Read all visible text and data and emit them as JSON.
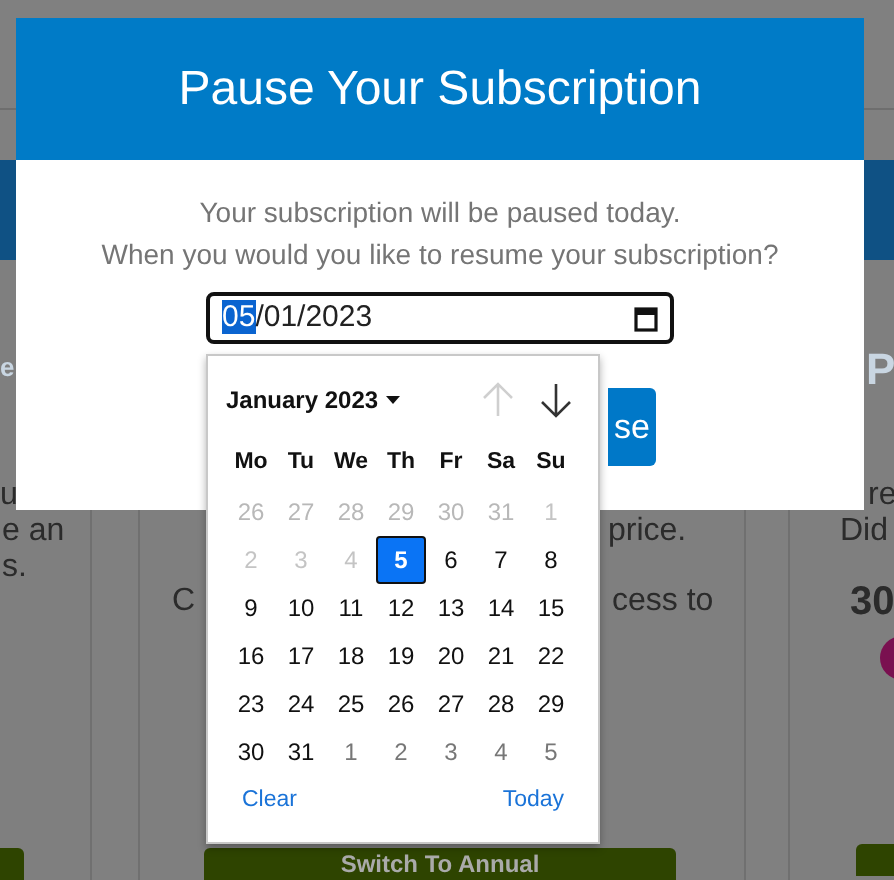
{
  "background": {
    "left": {
      "header": "e",
      "lines": [
        "u",
        "e an",
        "s."
      ]
    },
    "middle": {
      "lines": [
        "price.",
        "C",
        "cess to"
      ],
      "button": "Switch To Annual"
    },
    "right": {
      "header": "P",
      "lines": [
        "re",
        "Did"
      ],
      "price": "30"
    }
  },
  "modal": {
    "title": "Pause Your Subscription",
    "lines": [
      "Your subscription will be paused today.",
      "When you would you like to resume your subscription?"
    ],
    "date": {
      "segments": [
        {
          "text": "05",
          "selected": true
        },
        {
          "text": "/",
          "selected": false
        },
        {
          "text": "01",
          "selected": false
        },
        {
          "text": "/",
          "selected": false
        },
        {
          "text": "2023",
          "selected": false
        }
      ]
    },
    "button": "se"
  },
  "calendar": {
    "month": "January 2023",
    "prev_disabled": true,
    "next_disabled": false,
    "weekdays": [
      "Mo",
      "Tu",
      "We",
      "Th",
      "Fr",
      "Sa",
      "Su"
    ],
    "days": [
      {
        "text": "26",
        "disabled": true,
        "other_month": true,
        "selected": false
      },
      {
        "text": "27",
        "disabled": true,
        "other_month": true,
        "selected": false
      },
      {
        "text": "28",
        "disabled": true,
        "other_month": true,
        "selected": false
      },
      {
        "text": "29",
        "disabled": true,
        "other_month": true,
        "selected": false
      },
      {
        "text": "30",
        "disabled": true,
        "other_month": true,
        "selected": false
      },
      {
        "text": "31",
        "disabled": true,
        "other_month": true,
        "selected": false
      },
      {
        "text": "1",
        "disabled": true,
        "other_month": false,
        "selected": false
      },
      {
        "text": "2",
        "disabled": true,
        "other_month": false,
        "selected": false
      },
      {
        "text": "3",
        "disabled": true,
        "other_month": false,
        "selected": false
      },
      {
        "text": "4",
        "disabled": true,
        "other_month": false,
        "selected": false
      },
      {
        "text": "5",
        "disabled": false,
        "other_month": false,
        "selected": true
      },
      {
        "text": "6",
        "disabled": false,
        "other_month": false,
        "selected": false
      },
      {
        "text": "7",
        "disabled": false,
        "other_month": false,
        "selected": false
      },
      {
        "text": "8",
        "disabled": false,
        "other_month": false,
        "selected": false
      },
      {
        "text": "9",
        "disabled": false,
        "other_month": false,
        "selected": false
      },
      {
        "text": "10",
        "disabled": false,
        "other_month": false,
        "selected": false
      },
      {
        "text": "11",
        "disabled": false,
        "other_month": false,
        "selected": false
      },
      {
        "text": "12",
        "disabled": false,
        "other_month": false,
        "selected": false
      },
      {
        "text": "13",
        "disabled": false,
        "other_month": false,
        "selected": false
      },
      {
        "text": "14",
        "disabled": false,
        "other_month": false,
        "selected": false
      },
      {
        "text": "15",
        "disabled": false,
        "other_month": false,
        "selected": false
      },
      {
        "text": "16",
        "disabled": false,
        "other_month": false,
        "selected": false
      },
      {
        "text": "17",
        "disabled": false,
        "other_month": false,
        "selected": false
      },
      {
        "text": "18",
        "disabled": false,
        "other_month": false,
        "selected": false
      },
      {
        "text": "19",
        "disabled": false,
        "other_month": false,
        "selected": false
      },
      {
        "text": "20",
        "disabled": false,
        "other_month": false,
        "selected": false
      },
      {
        "text": "21",
        "disabled": false,
        "other_month": false,
        "selected": false
      },
      {
        "text": "22",
        "disabled": false,
        "other_month": false,
        "selected": false
      },
      {
        "text": "23",
        "disabled": false,
        "other_month": false,
        "selected": false
      },
      {
        "text": "24",
        "disabled": false,
        "other_month": false,
        "selected": false
      },
      {
        "text": "25",
        "disabled": false,
        "other_month": false,
        "selected": false
      },
      {
        "text": "26",
        "disabled": false,
        "other_month": false,
        "selected": false
      },
      {
        "text": "27",
        "disabled": false,
        "other_month": false,
        "selected": false
      },
      {
        "text": "28",
        "disabled": false,
        "other_month": false,
        "selected": false
      },
      {
        "text": "29",
        "disabled": false,
        "other_month": false,
        "selected": false
      },
      {
        "text": "30",
        "disabled": false,
        "other_month": false,
        "selected": false
      },
      {
        "text": "31",
        "disabled": false,
        "other_month": false,
        "selected": false
      },
      {
        "text": "1",
        "disabled": false,
        "other_month": true,
        "selected": false
      },
      {
        "text": "2",
        "disabled": false,
        "other_month": true,
        "selected": false
      },
      {
        "text": "3",
        "disabled": false,
        "other_month": true,
        "selected": false
      },
      {
        "text": "4",
        "disabled": false,
        "other_month": true,
        "selected": false
      },
      {
        "text": "5",
        "disabled": false,
        "other_month": true,
        "selected": false
      }
    ],
    "footer": [
      "Clear",
      "Today"
    ]
  }
}
